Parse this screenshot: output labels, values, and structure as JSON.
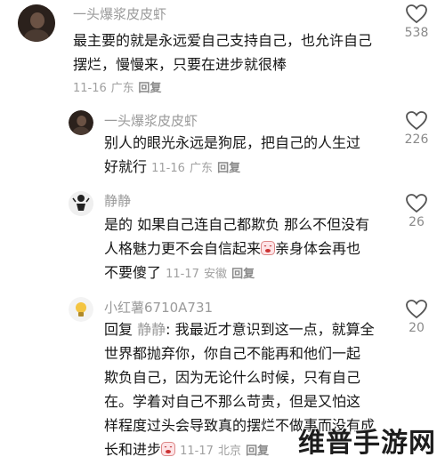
{
  "comments": [
    {
      "username": "一头爆浆皮皮虾",
      "lines": [
        "最主要的就是永远爱自己支持自己，也允许自己",
        "摆烂，慢慢来，只要在进步就很棒"
      ],
      "date": "11-16",
      "location": "广东",
      "reply_label": "回复",
      "likes": "538",
      "avatar_icon": "dark-portrait-avatar"
    },
    {
      "username": "一头爆浆皮皮虾",
      "line1": "别人的眼光永远是狗屁，把自己的人生过",
      "line2_text": "好就行",
      "date": "11-16",
      "location": "广东",
      "reply_label": "回复",
      "likes": "226",
      "avatar_icon": "dark-portrait-avatar"
    },
    {
      "username": "静静",
      "line1": "是的 如果自己连自己都欺负 那么不但没有",
      "line2_before": "人格魅力更不会自信起来",
      "line2_after": "亲身体会再也",
      "line3_text": "不要傻了",
      "date": "11-17",
      "location": "安徽",
      "reply_label": "回复",
      "likes": "26",
      "avatar_icon": "cartoon-figure-avatar",
      "emoji_icon": "crying-face-emoji"
    },
    {
      "username": "小红薯6710A731",
      "reply_prefix": "回复",
      "reply_to": "静静",
      "line1_text": ": 我最近才意识到这一点，就算全",
      "lines": [
        "世界都抛弃你，你自己不能再和他们一起",
        "欺负自己，因为无论什么时候，只有自己",
        "在。学着对自己不那么苛责，但是又怕这",
        "样程度过头会导致真的摆烂不做事而没有成"
      ],
      "last_line_text": "长和进步",
      "date": "11-17",
      "location": "北京",
      "reply_label": "回复",
      "likes": "20",
      "avatar_icon": "lightbulb-avatar",
      "emoji_icon": "crying-face-emoji"
    }
  ],
  "watermark": "维普手游网",
  "colors": {
    "text": "#161616",
    "muted": "#9a9a9a",
    "background": "#ffffff"
  }
}
